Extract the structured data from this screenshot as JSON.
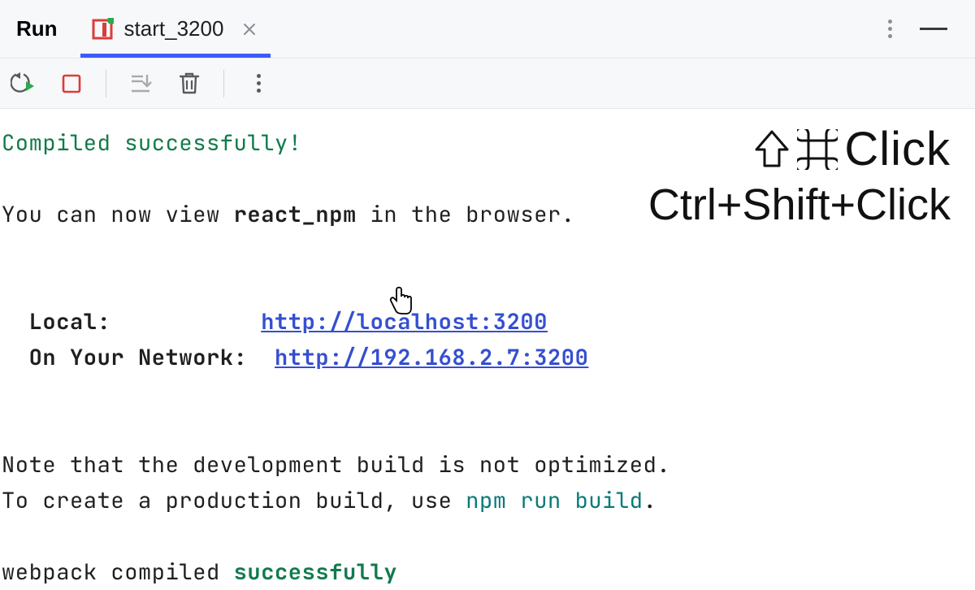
{
  "header": {
    "title": "Run",
    "tab": {
      "label": "start_3200"
    }
  },
  "overlay": {
    "mac": "⇧⌘Click",
    "winlinux": "Ctrl+Shift+Click"
  },
  "console": {
    "line1": "Compiled successfully!",
    "line2_prefix": "You can now view ",
    "line2_app": "react_npm",
    "line2_suffix": " in the browser.",
    "local_label": "  Local:           ",
    "local_url": "http://localhost:3200",
    "network_label": "  On Your Network:  ",
    "network_url": "http://192.168.2.7:3200",
    "note1": "Note that the development build is not optimized.",
    "note2_prefix": "To create a production build, use ",
    "note2_cmd": "npm run build",
    "note2_suffix": ".",
    "webpack_prefix": "webpack compiled ",
    "webpack_status": "successfully"
  }
}
